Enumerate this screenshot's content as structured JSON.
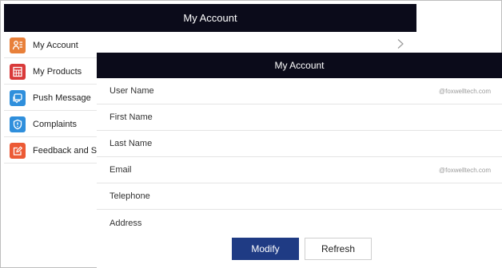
{
  "topbar": {
    "title": "My Account"
  },
  "sidebar": {
    "items": [
      {
        "label": "My Account",
        "icon": "user-list-icon",
        "color": "#e8803a"
      },
      {
        "label": "My Products",
        "icon": "calculator-icon",
        "color": "#d93a3a"
      },
      {
        "label": "Push Message",
        "icon": "chat-icon",
        "color": "#2f8fdc"
      },
      {
        "label": "Complaints",
        "icon": "shield-icon",
        "color": "#2f8fdc"
      },
      {
        "label": "Feedback and S",
        "icon": "edit-icon",
        "color": "#ec5a35"
      }
    ]
  },
  "panel": {
    "title": "My Account",
    "fields": [
      {
        "label": "User Name",
        "value": "@foxwelltech.com"
      },
      {
        "label": "First Name",
        "value": ""
      },
      {
        "label": "Last Name",
        "value": ""
      },
      {
        "label": "Email",
        "value": "@foxwelltech.com"
      },
      {
        "label": "Telephone",
        "value": ""
      },
      {
        "label": "Address",
        "value": ""
      }
    ]
  },
  "buttons": {
    "modify": "Modify",
    "refresh": "Refresh"
  },
  "colors": {
    "header_bg": "#0b0b1a",
    "primary_button": "#1f3b84"
  }
}
